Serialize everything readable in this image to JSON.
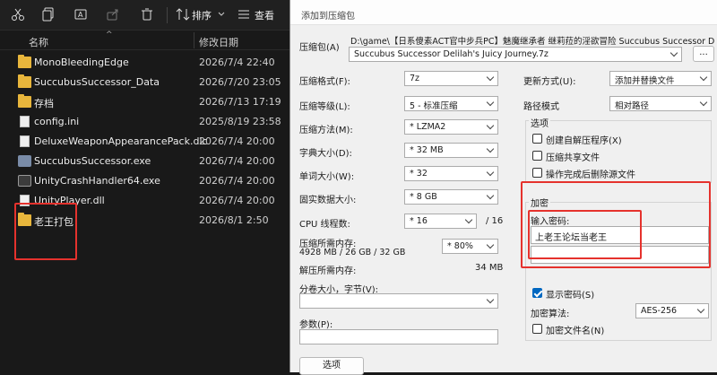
{
  "explorer": {
    "toolbar": {
      "sort_label": "排序",
      "view_label": "查看"
    },
    "columns": {
      "name": "名称",
      "date": "修改日期"
    },
    "files": [
      {
        "name": "MonoBleedingEdge",
        "date": "2026/7/4 22:40",
        "icon": "folder-icon"
      },
      {
        "name": "SuccubusSuccessor_Data",
        "date": "2026/7/20 23:05",
        "icon": "folder-icon"
      },
      {
        "name": "存档",
        "date": "2026/7/13 17:19",
        "icon": "folder-icon"
      },
      {
        "name": "config.ini",
        "date": "2025/8/19 23:58",
        "icon": "file-icon"
      },
      {
        "name": "DeluxeWeaponAppearancePack.dlc",
        "date": "2026/7/4 20:00",
        "icon": "file-icon"
      },
      {
        "name": "SuccubusSuccessor.exe",
        "date": "2026/7/4 20:00",
        "icon": "exe-icon"
      },
      {
        "name": "UnityCrashHandler64.exe",
        "date": "2026/7/4 20:00",
        "icon": "crash-handler-icon"
      },
      {
        "name": "UnityPlayer.dll",
        "date": "2026/7/4 20:00",
        "icon": "dll-icon"
      },
      {
        "name": "老王打包",
        "date": "2026/8/1 2:50",
        "icon": "folder-icon"
      }
    ],
    "highlight_color": "#e5322d"
  },
  "dialog": {
    "title": "添加到压缩包",
    "archive_label": "压缩包(A)",
    "archive_path": "D:\\game\\【日系傻素ACT官中步兵PC】魅魔继承者  继莉菈的淫欲冒险 Succubus Successor Delilah's Juicy",
    "archive_name": "Succubus Successor Delilah's Juicy Journey.7z",
    "browse_label": "...",
    "format_label": "压缩格式(F):",
    "format_value": "7z",
    "level_label": "压缩等级(L):",
    "level_value": "5 - 标准压缩",
    "method_label": "压缩方法(M):",
    "method_value": "* LZMA2",
    "dict_label": "字典大小(D):",
    "dict_value": "* 32 MB",
    "word_label": "单词大小(W):",
    "word_value": "* 32",
    "solid_label": "固实数据大小:",
    "solid_value": "* 8 GB",
    "cpu_label": "CPU 线程数:",
    "cpu_value": "* 16",
    "cpu_max": "/ 16",
    "mem_comp_label": "压缩所需内存:",
    "mem_comp_detail": "4928 MB / 26 GB / 32 GB",
    "mem_comp_value": "* 80%",
    "mem_decomp_label": "解压所需内存:",
    "mem_decomp_value": "34 MB",
    "split_label": "分卷大小，字节(V):",
    "params_label": "参数(P):",
    "options_button": "选项",
    "update_label": "更新方式(U):",
    "update_value": "添加并替换文件",
    "path_label": "路径模式",
    "path_value": "相对路径",
    "options_group": "选项",
    "opt_sfx": "创建自解压程序(X)",
    "opt_shared": "压缩共享文件",
    "opt_delete": "操作完成后删除源文件",
    "enc_group": "加密",
    "pwd_label": "输入密码:",
    "pwd_value": "上老王论坛当老王",
    "show_pwd": "显示密码(S)",
    "enc_method_label": "加密算法:",
    "enc_method_value": "AES-256",
    "enc_names": "加密文件名(N)"
  }
}
